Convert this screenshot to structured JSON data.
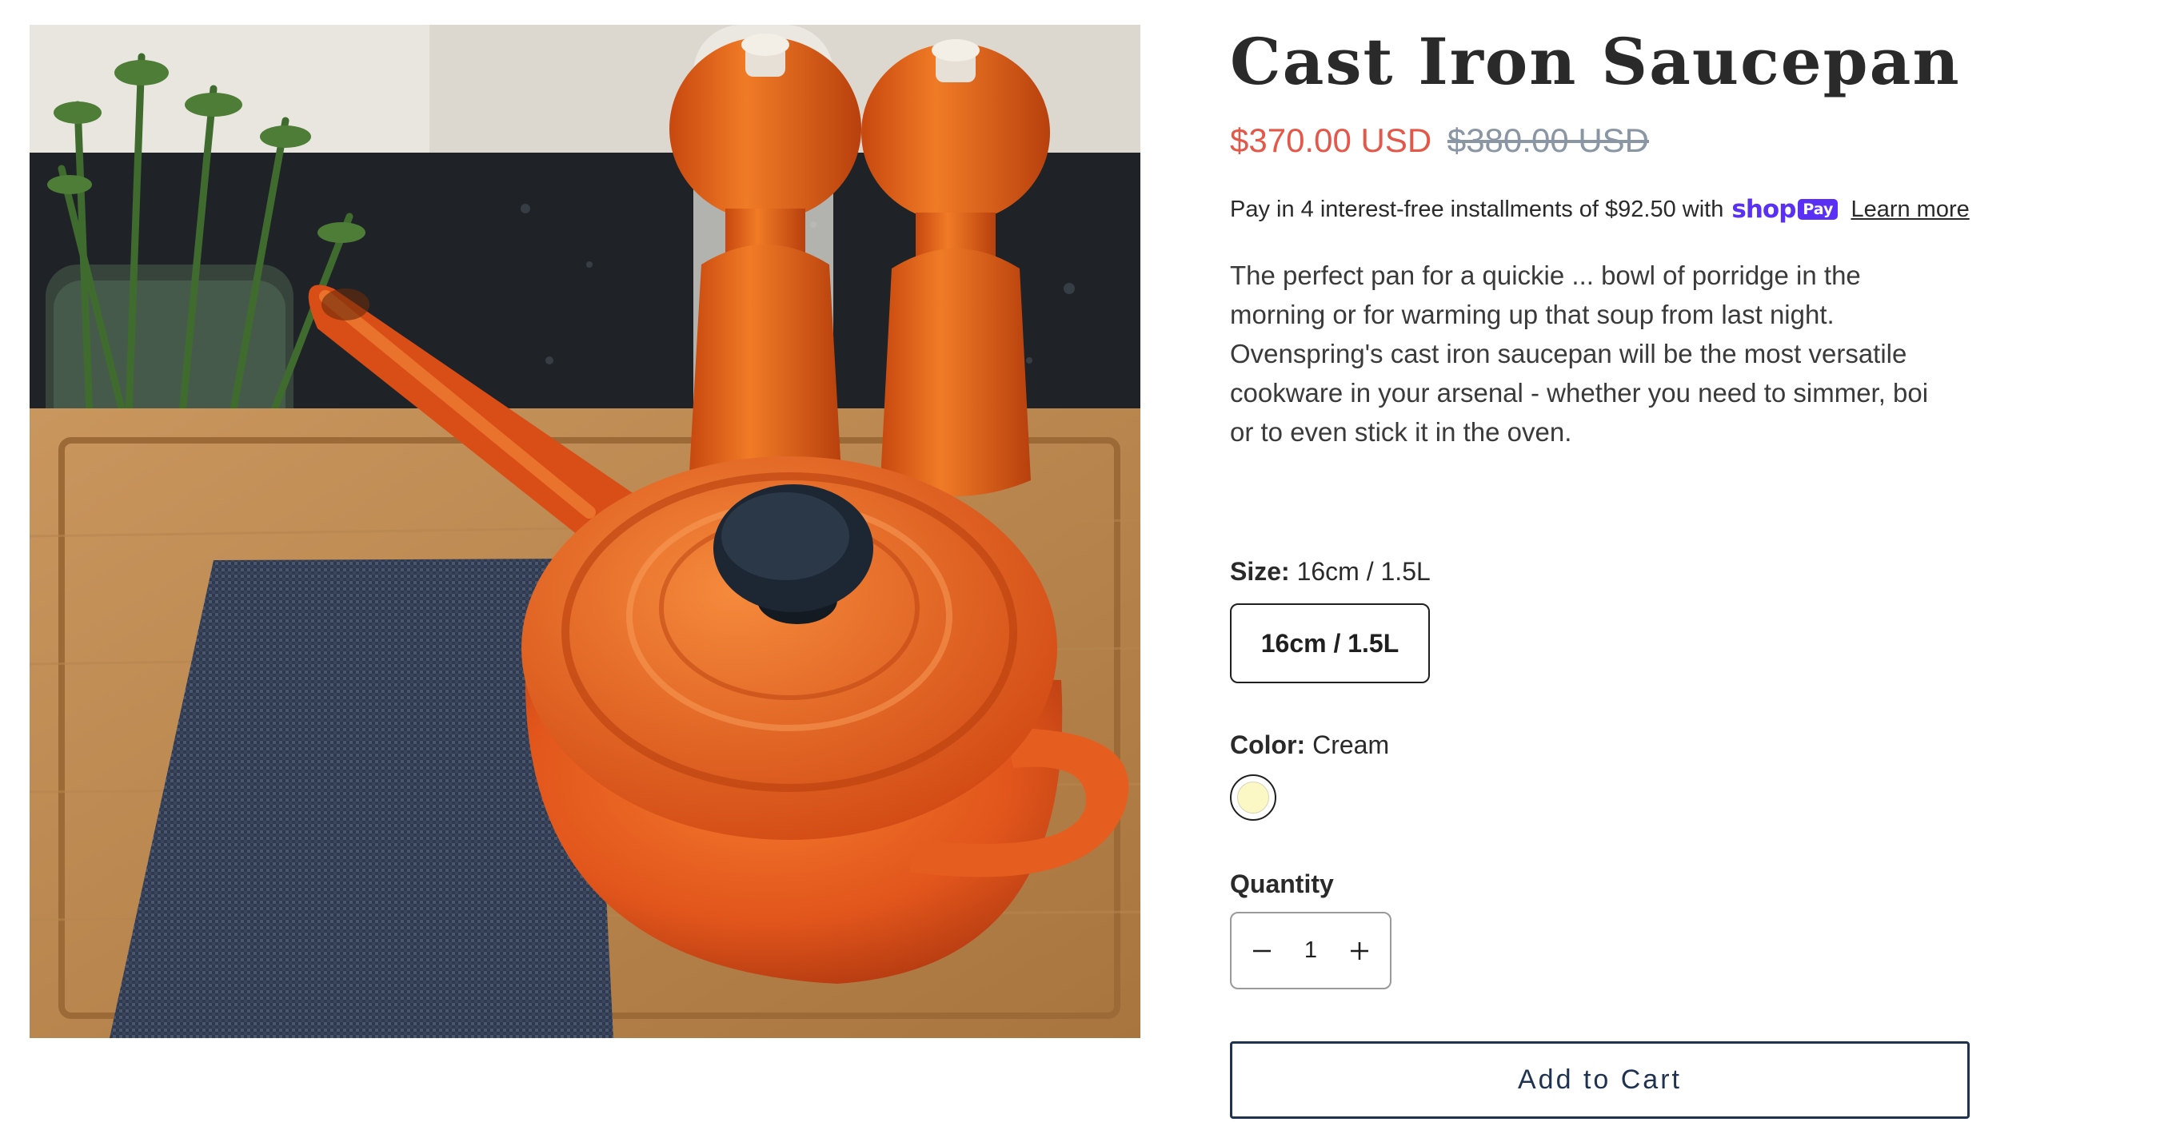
{
  "product": {
    "title": "Cast Iron Saucepan",
    "image_alt": "Orange cast iron saucepan with pepper mills on a cutting board",
    "price": {
      "sale": "$370.00 USD",
      "compare_at": "$380.00 USD",
      "sale_color": "#e4584a"
    },
    "installments": {
      "text": "Pay in 4 interest-free installments of $92.50 with",
      "brand_word": "shop",
      "brand_badge": "Pay",
      "brand_color": "#5a31f4",
      "learn_more": "Learn more"
    },
    "description": "The perfect pan for a quickie ... bowl of porridge in the morning or for warming up that soup from last night. Ovenspring's cast iron saucepan will be the most versatile cookware in your arsenal - whether you need to simmer, boi or to even stick it in the oven.",
    "size": {
      "label": "Size:",
      "selected": "16cm / 1.5L",
      "options": [
        "16cm / 1.5L"
      ]
    },
    "color": {
      "label": "Color:",
      "selected": "Cream",
      "swatch_color": "#fbf8c6"
    },
    "quantity": {
      "label": "Quantity",
      "value": "1",
      "decrease_icon": "minus-icon",
      "increase_icon": "plus-icon"
    },
    "add_to_cart": "Add to Cart"
  }
}
